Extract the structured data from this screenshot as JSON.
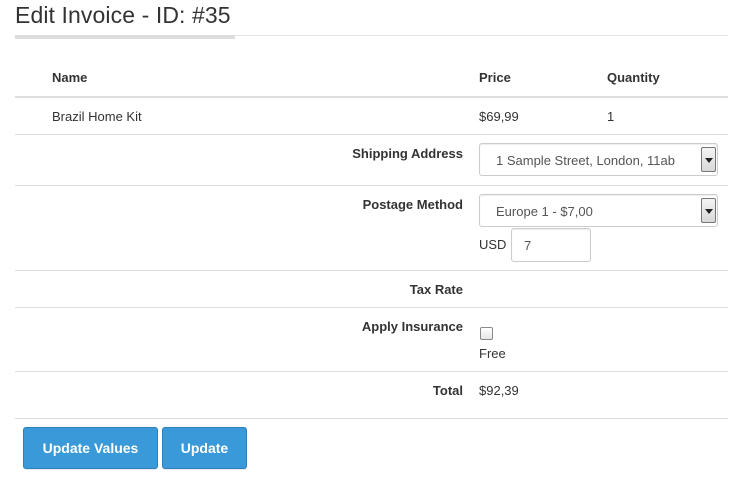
{
  "page": {
    "title": "Edit Invoice - ID: #35"
  },
  "table": {
    "headers": {
      "name": "Name",
      "price": "Price",
      "quantity": "Quantity"
    },
    "items": [
      {
        "name": "Brazil Home Kit",
        "price": "$69,99",
        "quantity": "1"
      }
    ]
  },
  "shipping_address": {
    "label": "Shipping Address",
    "selected": "1 Sample Street, London, 11ab"
  },
  "postage_method": {
    "label": "Postage Method",
    "selected": "Europe 1 - $7,00",
    "currency": "USD",
    "amount": "7"
  },
  "tax_rate": {
    "label": "Tax Rate",
    "value": ""
  },
  "insurance": {
    "label": "Apply Insurance",
    "checked": false,
    "note": "Free"
  },
  "total": {
    "label": "Total",
    "value": "$92,39"
  },
  "buttons": {
    "update_values": "Update Values",
    "update": "Update"
  },
  "colors": {
    "button_bg": "#3a9ad9",
    "button_border": "#2d7fb7",
    "text": "#333333"
  }
}
